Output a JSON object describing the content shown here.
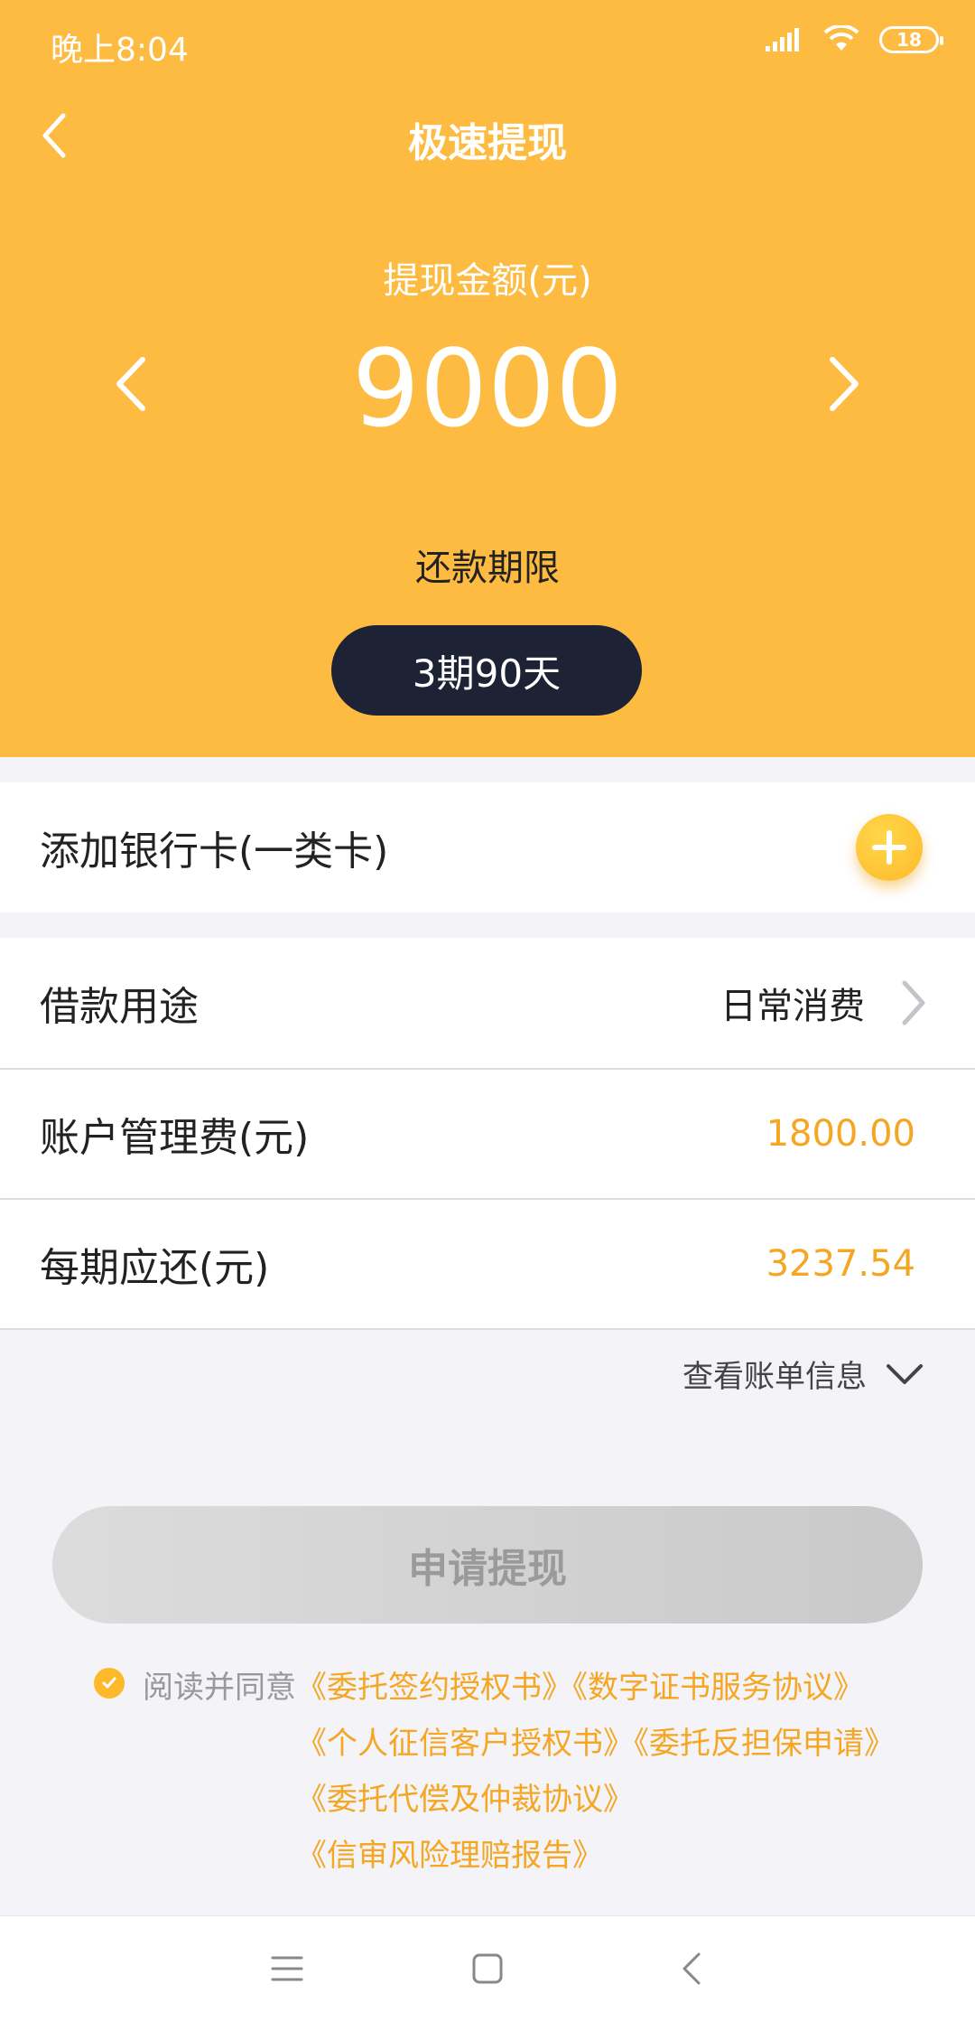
{
  "status_bar": {
    "time": "晚上8:04",
    "battery": "18"
  },
  "nav": {
    "title": "极速提现"
  },
  "amount": {
    "label": "提现金额(元)",
    "value": "9000"
  },
  "term": {
    "label": "还款期限",
    "selected": "3期90天"
  },
  "bank_card": {
    "label": "添加银行卡(一类卡)"
  },
  "rows": [
    {
      "label": "借款用途",
      "value": "日常消费"
    },
    {
      "label": "账户管理费(元)",
      "value": "1800.00"
    },
    {
      "label": "每期应还(元)",
      "value": "3237.54"
    }
  ],
  "bill_info": {
    "label": "查看账单信息"
  },
  "apply_button": {
    "label": "申请提现"
  },
  "agreement": {
    "prefix": "阅读并同意",
    "line1": "《委托签约授权书》《数字证书服务协议》",
    "line2": "《个人征信客户授权书》《委托反担保申请》",
    "line3": "《委托代偿及仲裁协议》",
    "line4": "《信审风险理赔报告》"
  },
  "colors": {
    "header_bg": "#fdbb41",
    "pill_bg": "#1e2235",
    "accent": "#f5a623"
  }
}
